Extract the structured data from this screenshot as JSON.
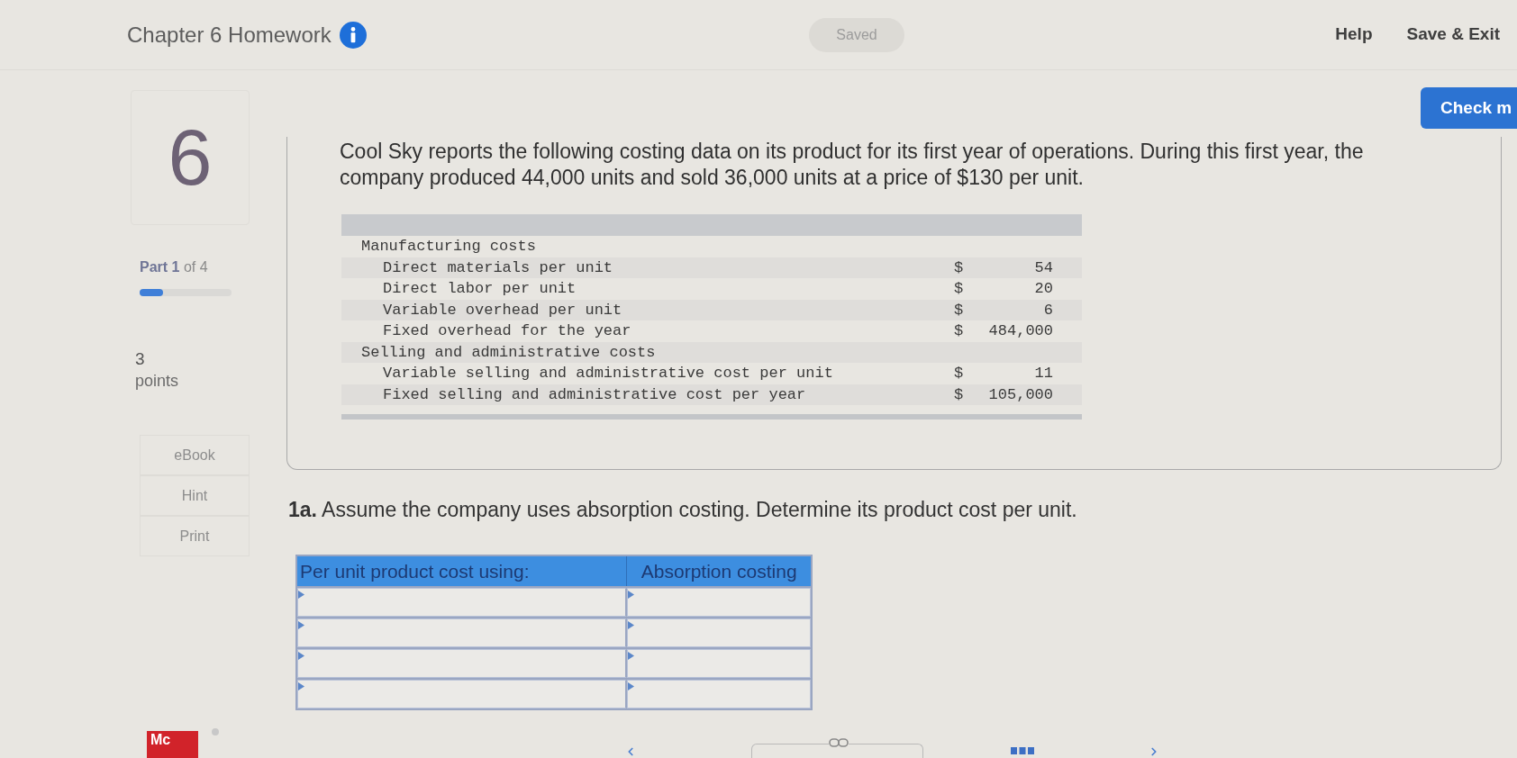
{
  "header": {
    "title": "Chapter 6 Homework",
    "status": "Saved",
    "links": [
      "Help",
      "Save & Exit"
    ]
  },
  "check_button": "Check m",
  "sidebar": {
    "question_number": "6",
    "part": {
      "label": "**Part 1** of 4",
      "level": 0.25
    },
    "points": {
      "value": "3",
      "label": "points"
    },
    "tools": [
      "eBook",
      "Hint",
      "Print"
    ]
  },
  "question": {
    "text": "Cool Sky reports the following costing data on its product for its first year of operations. During this first year, the company produced 44,000 units and sold 36,000 units at a price of $130 per unit.",
    "data_table": {
      "groups": [
        {
          "label": "Manufacturing costs",
          "children": [
            {
              "label": "Direct materials per unit",
              "currency": "$",
              "value": "54"
            },
            {
              "label": "Direct labor per unit",
              "currency": "$",
              "value": "20"
            },
            {
              "label": "Variable overhead per unit",
              "currency": "$",
              "value": "6"
            },
            {
              "label": "Fixed overhead for the year",
              "currency": "$",
              "value": "484,000"
            }
          ]
        },
        {
          "label": "Selling and administrative costs",
          "children": [
            {
              "label": "Variable selling and administrative cost per unit",
              "currency": "$",
              "value": "11"
            },
            {
              "label": "Fixed selling and administrative cost per year",
              "currency": "$",
              "value": "105,000"
            }
          ]
        }
      ]
    }
  },
  "part_1a": {
    "prompt": "**1a.** Assume the company uses absorption costing. Determine its product cost per unit.",
    "table": {
      "columns": [
        "Per unit product cost using:",
        "Absorption costing"
      ],
      "rows": [
        {
          "kind": "entry"
        },
        {
          "kind": "entry"
        },
        {
          "kind": "entry"
        },
        {
          "kind": "entry"
        }
      ]
    }
  },
  "footer": {
    "logo": "Mc"
  }
}
